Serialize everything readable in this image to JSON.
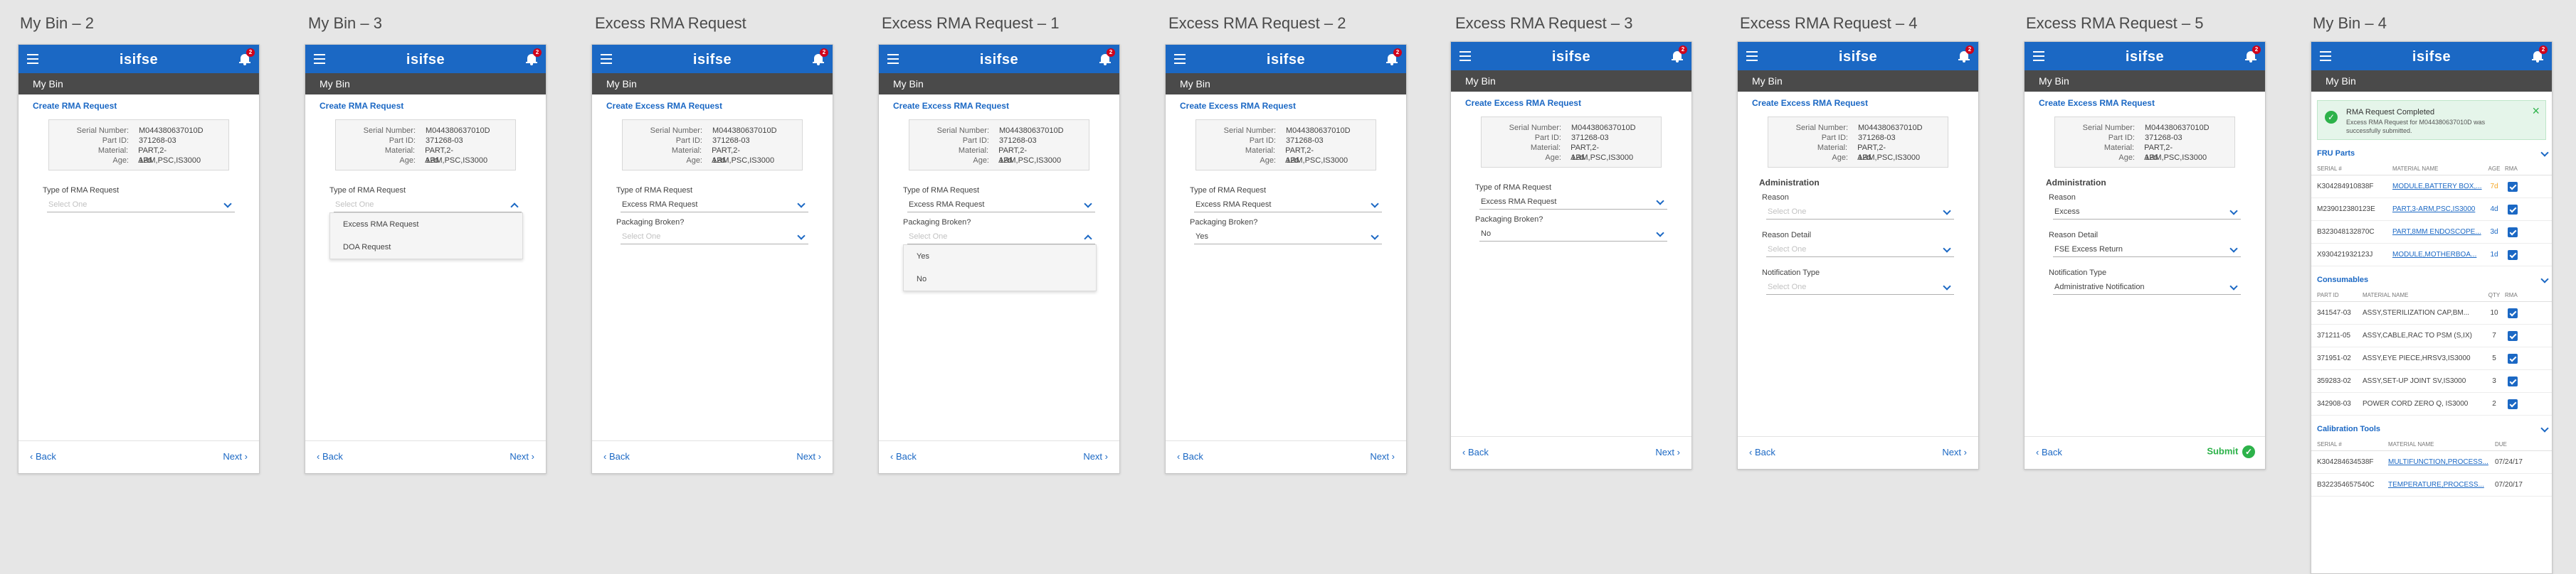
{
  "app": {
    "title": "isifse",
    "badge": "2",
    "subbar": "My Bin"
  },
  "common": {
    "back": "Back",
    "next": "Next",
    "submit": "Submit",
    "select_one": "Select One",
    "serial_label": "Serial Number:",
    "part_label": "Part ID:",
    "material_label": "Material:",
    "age_label": "Age:",
    "serial_value": "M044380637010D",
    "part_value": "371268-03",
    "material_value": "PART,2-ARM,PSC,IS3000",
    "age_value": "12d"
  },
  "screens": {
    "s1": {
      "label": "My Bin – 2",
      "link": "Create RMA Request",
      "type_label": "Type of RMA Request"
    },
    "s2": {
      "label": "My Bin – 3",
      "link": "Create RMA Request",
      "type_label": "Type of RMA Request",
      "options": [
        "Excess RMA Request",
        "DOA Request"
      ]
    },
    "s3": {
      "label": "Excess RMA Request",
      "link": "Create Excess RMA Request",
      "type_label": "Type of RMA Request",
      "type_value": "Excess RMA Request",
      "pack_label": "Packaging Broken?"
    },
    "s4": {
      "label": "Excess RMA Request – 1",
      "link": "Create Excess RMA Request",
      "type_label": "Type of RMA Request",
      "type_value": "Excess RMA Request",
      "pack_label": "Packaging Broken?",
      "options": [
        "Yes",
        "No"
      ]
    },
    "s5": {
      "label": "Excess RMA Request – 2",
      "link": "Create Excess RMA Request",
      "type_label": "Type of RMA Request",
      "type_value": "Excess RMA Request",
      "pack_label": "Packaging Broken?",
      "pack_value": "Yes"
    },
    "s6": {
      "label": "Excess RMA Request – 3",
      "link": "Create Excess RMA Request",
      "type_label": "Type of RMA Request",
      "type_value": "Excess RMA Request",
      "pack_label": "Packaging Broken?",
      "pack_value": "No"
    },
    "s7": {
      "label": "Excess RMA Request – 4",
      "link": "Create Excess RMA Request",
      "admin": "Administration",
      "reason_label": "Reason",
      "reason_detail_label": "Reason Detail",
      "notification_label": "Notification Type"
    },
    "s8": {
      "label": "Excess RMA Request – 5",
      "link": "Create Excess RMA Request",
      "admin": "Administration",
      "reason_label": "Reason",
      "reason_value": "Excess",
      "reason_detail_label": "Reason Detail",
      "reason_detail_value": "FSE Excess Return",
      "notification_label": "Notification Type",
      "notification_value": "Administrative Notification"
    },
    "s9": {
      "label": "My Bin – 4",
      "alert_title": "RMA Request Completed",
      "alert_text": "Excess RMA Request for M044380637010D was successfully submitted.",
      "fru": {
        "title": "FRU Parts",
        "headers": [
          "SERIAL #",
          "MATERIAL NAME",
          "AGE",
          "RMA"
        ],
        "rows": [
          {
            "serial": "K304284910838F",
            "name": "MODULE,BATTERY BOX,...",
            "age": "7d"
          },
          {
            "serial": "M239012380123E",
            "name": "PART,3-ARM,PSC,IS3000",
            "age": "4d"
          },
          {
            "serial": "B323048132870C",
            "name": "PART,8MM ENDOSCOPE...",
            "age": "3d"
          },
          {
            "serial": "X930421932123J",
            "name": "MODULE,MOTHERBOA...",
            "age": "1d"
          }
        ]
      },
      "consumables": {
        "title": "Consumables",
        "headers": [
          "PART ID",
          "MATERIAL NAME",
          "QTY",
          "RMA"
        ],
        "rows": [
          {
            "part": "341547-03",
            "name": "ASSY,STERILIZATION CAP,BM...",
            "qty": "10"
          },
          {
            "part": "371211-05",
            "name": "ASSY,CABLE,RAC TO PSM (S,IX)",
            "qty": "7"
          },
          {
            "part": "371951-02",
            "name": "ASSY,EYE PIECE,HRSV3,IS3000",
            "qty": "5"
          },
          {
            "part": "359283-02",
            "name": "ASSY,SET-UP JOINT SV,IS3000",
            "qty": "3"
          },
          {
            "part": "342908-03",
            "name": "POWER CORD ZERO Q, IS3000",
            "qty": "2"
          }
        ]
      },
      "calibration": {
        "title": "Calibration Tools",
        "headers": [
          "SERIAL #",
          "MATERIAL NAME",
          "DUE"
        ],
        "rows": [
          {
            "serial": "K304284634538F",
            "name": "MULTIFUNCTION,PROCESS...",
            "due": "07/24/17"
          },
          {
            "serial": "B322354657540C",
            "name": "TEMPERATURE,PROCESS...",
            "due": "07/20/17"
          }
        ]
      }
    }
  }
}
